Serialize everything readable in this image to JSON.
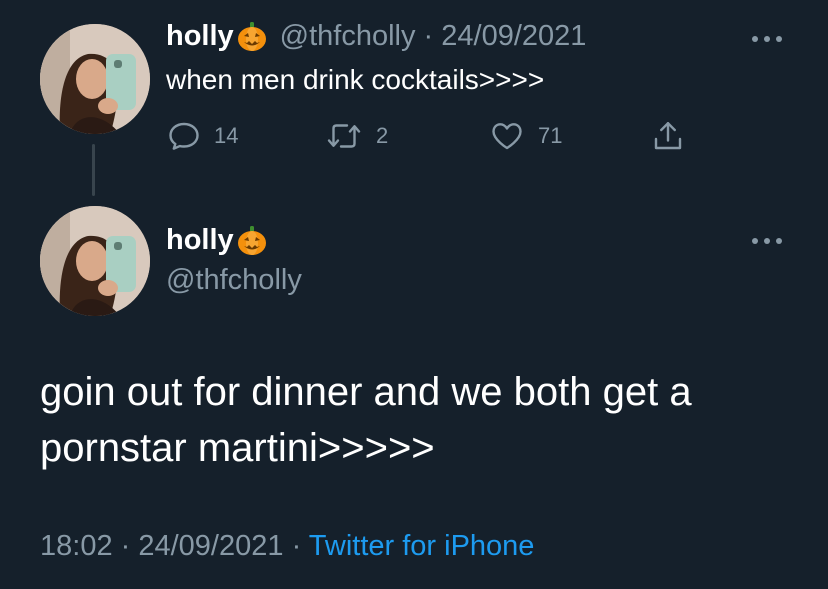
{
  "tweet1": {
    "name": "holly",
    "name_emoji": "jack-o-lantern-emoji",
    "handle": "@thfcholly",
    "separator": " · ",
    "date": "24/09/2021",
    "text": "when men drink cocktails>>>>",
    "replies": "14",
    "retweets": "2",
    "likes": "71"
  },
  "tweet2": {
    "name": "holly",
    "name_emoji": "jack-o-lantern-emoji",
    "handle": "@thfcholly",
    "text_line1": "goin out for dinner and we both get a",
    "text_line2": "pornstar martini>>>>>",
    "time": "18:02",
    "separator": " · ",
    "date": "24/09/2021",
    "separator2": " · ",
    "source": "Twitter for iPhone"
  },
  "colors": {
    "background": "#15202b",
    "text": "#ffffff",
    "muted": "#8899a6",
    "link": "#1d9bf0",
    "thread_line": "#38444d"
  },
  "icons": [
    "reply-icon",
    "retweet-icon",
    "like-icon",
    "share-icon",
    "more-icon"
  ]
}
